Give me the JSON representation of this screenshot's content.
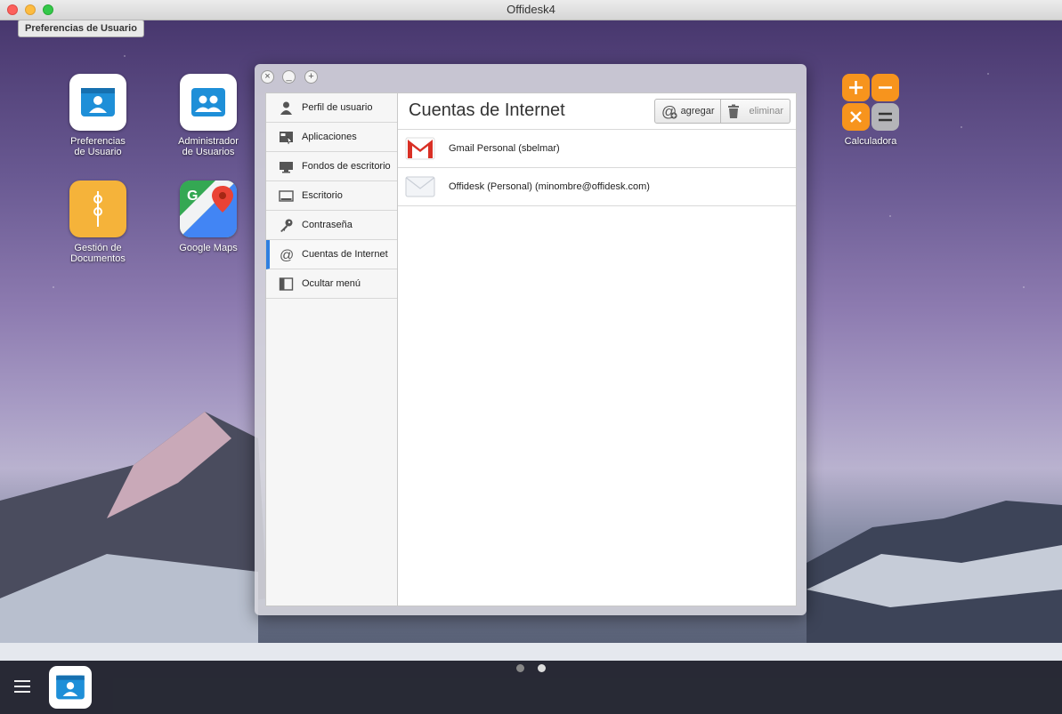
{
  "window": {
    "title": "Offidesk4"
  },
  "tooltip": "Preferencias de Usuario",
  "desktop": {
    "apps": [
      {
        "label_line1": "Preferencias",
        "label_line2": "de Usuario"
      },
      {
        "label_line1": "Administrador",
        "label_line2": "de Usuarios"
      },
      {
        "label_line1": "Gestión de",
        "label_line2": "Documentos"
      },
      {
        "label_line1": "Google Maps",
        "label_line2": ""
      },
      {
        "label_line1": "Calculadora",
        "label_line2": ""
      }
    ]
  },
  "prefs": {
    "window_buttons": [
      "×",
      "_",
      "+"
    ],
    "sidebar": [
      {
        "label": "Perfil de usuario",
        "icon": "user-icon"
      },
      {
        "label": "Aplicaciones",
        "icon": "apps-icon"
      },
      {
        "label": "Fondos de escritorio",
        "icon": "monitor-icon"
      },
      {
        "label": "Escritorio",
        "icon": "desktop-icon"
      },
      {
        "label": "Contraseña",
        "icon": "key-icon"
      },
      {
        "label": "Cuentas de Internet",
        "icon": "at-icon",
        "active": true
      },
      {
        "label": "Ocultar menú",
        "icon": "sidebar-icon"
      }
    ],
    "title": "Cuentas de Internet",
    "toolbar": {
      "add_label": "agregar",
      "delete_label": "eliminar"
    },
    "accounts": [
      {
        "label": "Gmail Personal (sbelmar)",
        "icon": "gmail-icon"
      },
      {
        "label": "Offidesk (Personal) (minombre@offidesk.com)",
        "icon": "mail-envelope-icon"
      }
    ]
  },
  "dock": {
    "pages": 2,
    "active_page": 2
  },
  "colors": {
    "accent": "#2f7fe0",
    "calc_orange": "#f7941d",
    "folder_yellow": "#f5b33a",
    "app_blue": "#1e8fd8"
  }
}
